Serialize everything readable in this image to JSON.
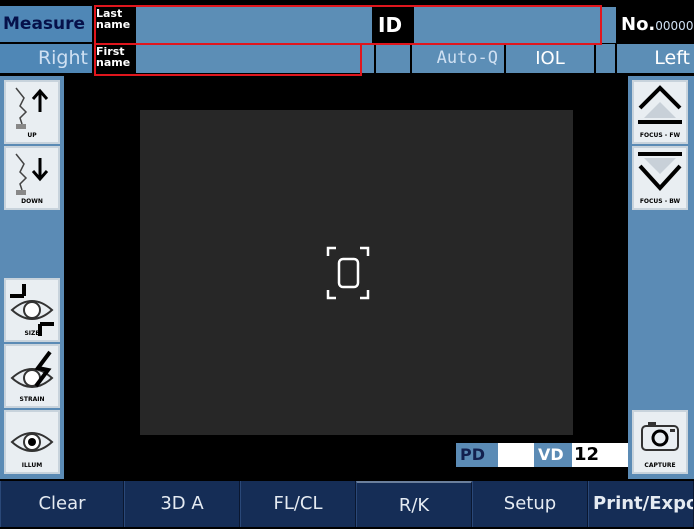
{
  "header": {
    "measure": "Measure",
    "right_eye": "Right",
    "last_name_label": "Last\nname",
    "first_name_label": "First\nname",
    "id_label": "ID",
    "no_label": "No.",
    "no_value": "00000",
    "auto_q": "Auto-Q",
    "iol": "IOL",
    "left_eye": "Left"
  },
  "left_panel": {
    "up": "UP",
    "down": "DOWN",
    "size": "SIZE",
    "strain": "STRAIN",
    "illum": "ILLUM"
  },
  "right_panel": {
    "focus_fw": "FOCUS - FW",
    "focus_bw": "FOCUS - BW",
    "capture": "CAPTURE"
  },
  "readouts": {
    "pd_label": "PD",
    "pd_value": "",
    "vd_label": "VD",
    "vd_value": "12"
  },
  "toolbar": {
    "clear": "Clear",
    "3d_a": "3D A",
    "fl_cl": "FL/CL",
    "r_k": "R/K",
    "setup": "Setup",
    "print_export": "Print/Export"
  },
  "colors": {
    "accent": "#5b8bb5",
    "toolbar_bg": "#152d56",
    "highlight": "#e0161d"
  }
}
